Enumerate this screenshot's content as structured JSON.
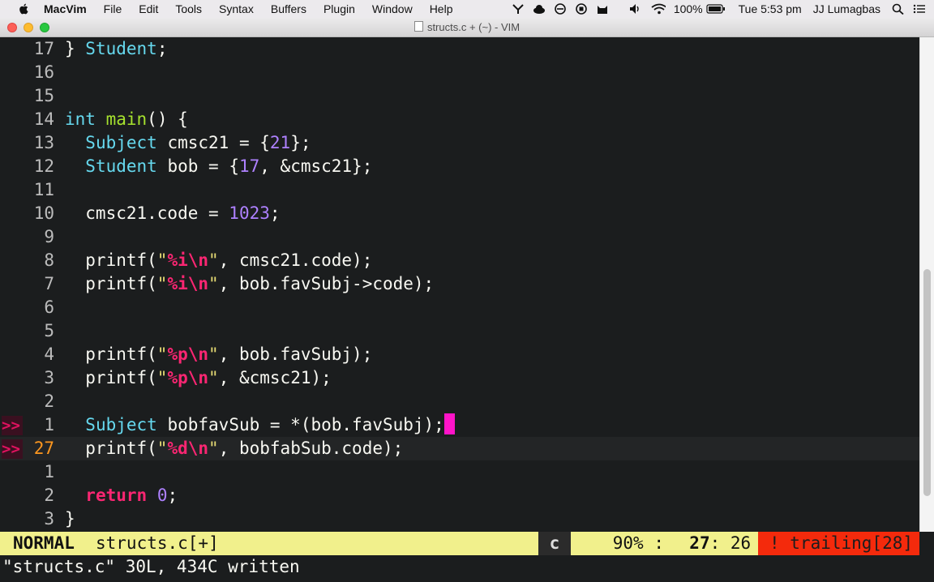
{
  "menubar": {
    "app_name": "MacVim",
    "items": [
      "File",
      "Edit",
      "Tools",
      "Syntax",
      "Buffers",
      "Plugin",
      "Window",
      "Help"
    ],
    "battery": "100%",
    "clock": "Tue 5:53 pm",
    "user": "JJ Lumagbas"
  },
  "window": {
    "title": "structs.c + (~) - VIM"
  },
  "editor": {
    "lines": [
      {
        "num": "17",
        "sign": "",
        "current": false,
        "tokens": [
          {
            "t": "} ",
            "c": ""
          },
          {
            "t": "Student",
            "c": "t-type"
          },
          {
            "t": ";",
            "c": ""
          }
        ]
      },
      {
        "num": "16",
        "sign": "",
        "current": false,
        "tokens": []
      },
      {
        "num": "15",
        "sign": "",
        "current": false,
        "tokens": []
      },
      {
        "num": "14",
        "sign": "",
        "current": false,
        "tokens": [
          {
            "t": "int",
            "c": "t-type"
          },
          {
            "t": " ",
            "c": ""
          },
          {
            "t": "main",
            "c": "t-fn"
          },
          {
            "t": "() {",
            "c": ""
          }
        ]
      },
      {
        "num": "13",
        "sign": "",
        "current": false,
        "tokens": [
          {
            "t": "  ",
            "c": ""
          },
          {
            "t": "Subject",
            "c": "t-type"
          },
          {
            "t": " cmsc21 = {",
            "c": ""
          },
          {
            "t": "21",
            "c": "t-num"
          },
          {
            "t": "};",
            "c": ""
          }
        ]
      },
      {
        "num": "12",
        "sign": "",
        "current": false,
        "tokens": [
          {
            "t": "  ",
            "c": ""
          },
          {
            "t": "Student",
            "c": "t-type"
          },
          {
            "t": " bob = {",
            "c": ""
          },
          {
            "t": "17",
            "c": "t-num"
          },
          {
            "t": ", &cmsc21};",
            "c": ""
          }
        ]
      },
      {
        "num": "11",
        "sign": "",
        "current": false,
        "tokens": []
      },
      {
        "num": "10",
        "sign": "",
        "current": false,
        "tokens": [
          {
            "t": "  cmsc21.code = ",
            "c": ""
          },
          {
            "t": "1023",
            "c": "t-num"
          },
          {
            "t": ";",
            "c": ""
          }
        ]
      },
      {
        "num": "9",
        "sign": "",
        "current": false,
        "tokens": []
      },
      {
        "num": "8",
        "sign": "",
        "current": false,
        "tokens": [
          {
            "t": "  printf(",
            "c": ""
          },
          {
            "t": "\"",
            "c": "t-str"
          },
          {
            "t": "%i\\n",
            "c": "t-fmt"
          },
          {
            "t": "\"",
            "c": "t-str"
          },
          {
            "t": ", cmsc21.code);",
            "c": ""
          }
        ]
      },
      {
        "num": "7",
        "sign": "",
        "current": false,
        "tokens": [
          {
            "t": "  printf(",
            "c": ""
          },
          {
            "t": "\"",
            "c": "t-str"
          },
          {
            "t": "%i\\n",
            "c": "t-fmt"
          },
          {
            "t": "\"",
            "c": "t-str"
          },
          {
            "t": ", bob.favSubj->code);",
            "c": ""
          }
        ]
      },
      {
        "num": "6",
        "sign": "",
        "current": false,
        "tokens": []
      },
      {
        "num": "5",
        "sign": "",
        "current": false,
        "tokens": []
      },
      {
        "num": "4",
        "sign": "",
        "current": false,
        "tokens": [
          {
            "t": "  printf(",
            "c": ""
          },
          {
            "t": "\"",
            "c": "t-str"
          },
          {
            "t": "%p\\n",
            "c": "t-fmt"
          },
          {
            "t": "\"",
            "c": "t-str"
          },
          {
            "t": ", bob.favSubj);",
            "c": ""
          }
        ]
      },
      {
        "num": "3",
        "sign": "",
        "current": false,
        "tokens": [
          {
            "t": "  printf(",
            "c": ""
          },
          {
            "t": "\"",
            "c": "t-str"
          },
          {
            "t": "%p\\n",
            "c": "t-fmt"
          },
          {
            "t": "\"",
            "c": "t-str"
          },
          {
            "t": ", &cmsc21);",
            "c": ""
          }
        ]
      },
      {
        "num": "2",
        "sign": "",
        "current": false,
        "tokens": []
      },
      {
        "num": "1",
        "sign": ">>",
        "current": false,
        "tokens": [
          {
            "t": "  ",
            "c": ""
          },
          {
            "t": "Subject",
            "c": "t-type"
          },
          {
            "t": " bobfavSub = *(bob.favSubj);",
            "c": ""
          }
        ],
        "cursor": true
      },
      {
        "num": "27",
        "sign": ">>",
        "current": true,
        "tokens": [
          {
            "t": "  printf(",
            "c": ""
          },
          {
            "t": "\"",
            "c": "t-str"
          },
          {
            "t": "%d\\n",
            "c": "t-fmt"
          },
          {
            "t": "\"",
            "c": "t-str"
          },
          {
            "t": ", bobfabSub.code);",
            "c": ""
          }
        ]
      },
      {
        "num": "1",
        "sign": "",
        "current": false,
        "tokens": []
      },
      {
        "num": "2",
        "sign": "",
        "current": false,
        "tokens": [
          {
            "t": "  ",
            "c": ""
          },
          {
            "t": "return",
            "c": "t-kw"
          },
          {
            "t": " ",
            "c": ""
          },
          {
            "t": "0",
            "c": "t-num"
          },
          {
            "t": ";",
            "c": ""
          }
        ]
      },
      {
        "num": "3",
        "sign": "",
        "current": false,
        "tokens": [
          {
            "t": "}",
            "c": ""
          }
        ]
      }
    ]
  },
  "statusline": {
    "mode": "NORMAL",
    "file": "structs.c[+]",
    "filetype": "c",
    "percent": "90%",
    "sep": ":",
    "line": "27",
    "col": "26",
    "warning": "! trailing[28]"
  },
  "cmdline": {
    "message": "\"structs.c\" 30L, 434C written"
  },
  "scrollbar": {
    "position_fraction": 0.9
  },
  "colors": {
    "background": "#1b1d1e",
    "type": "#66d9ef",
    "function": "#a6e22e",
    "number": "#ae81ff",
    "keyword": "#f92672",
    "statusline": "#f1f08c",
    "warning": "#f42a0c",
    "cursor": "#ff14c8"
  }
}
